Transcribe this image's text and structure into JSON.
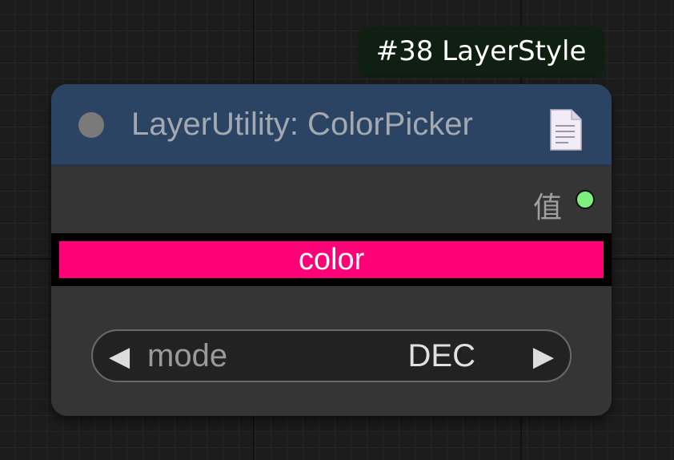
{
  "node": {
    "badge": "#38 LayerStyle",
    "title": "LayerUtility: ColorPicker",
    "output_label": "值",
    "output_slot_color": "#7cf07c",
    "header_color": "#2c4464",
    "body_color": "#353535",
    "icons": {
      "collapse": "collapse-dot-icon",
      "document": "document-icon"
    }
  },
  "widgets": {
    "color": {
      "label": "color",
      "value_color": "#ff0077"
    },
    "mode": {
      "label": "mode",
      "value": "DEC",
      "left_arrow": "◀",
      "right_arrow": "▶"
    }
  }
}
